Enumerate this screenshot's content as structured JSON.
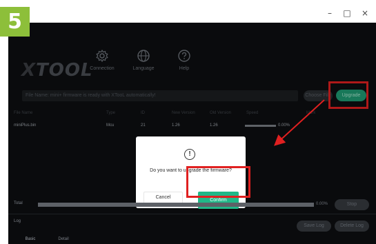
{
  "step_badge": "5",
  "window_controls": {
    "minimize": "–",
    "maximize": "□",
    "close": "×"
  },
  "logo": {
    "x": "X",
    "rest": "TOOL"
  },
  "nav": [
    {
      "label": "Connection",
      "icon": "gear-icon"
    },
    {
      "label": "Language",
      "icon": "globe-icon"
    },
    {
      "label": "Help",
      "icon": "question-icon"
    }
  ],
  "file_bar": {
    "text": "File Name: mini+ firmware is ready with XTooL automatically!"
  },
  "buttons": {
    "choose_file": "Choose File",
    "upgrade": "Upgrade",
    "stop": "Stop",
    "save_log": "Save Log",
    "delete_log": "Delete Log"
  },
  "table": {
    "headers": [
      "File Name",
      "Type",
      "ID",
      "New Version",
      "Old Version",
      "Speed",
      "Mark"
    ],
    "rows": [
      {
        "file": "miniPlus.bin",
        "type": "Mcu",
        "id": "21",
        "new": "1.26",
        "old": "1.26",
        "progress": 0.0,
        "speed": "0.00%"
      }
    ]
  },
  "dialog": {
    "icon": "info-icon",
    "message": "Do you want to upgrade the firmware?",
    "cancel": "Cancel",
    "confirm": "Confirm"
  },
  "total": {
    "label": "Total",
    "progress": 0.0,
    "percent": "0.00%"
  },
  "log": {
    "label": "Log"
  },
  "tabs": [
    "Basic",
    "Detail"
  ],
  "colors": {
    "accent_green": "#20b888",
    "highlight_red": "#e02020",
    "badge_green": "#8dbf3a",
    "app_background": "#0d0f11"
  }
}
